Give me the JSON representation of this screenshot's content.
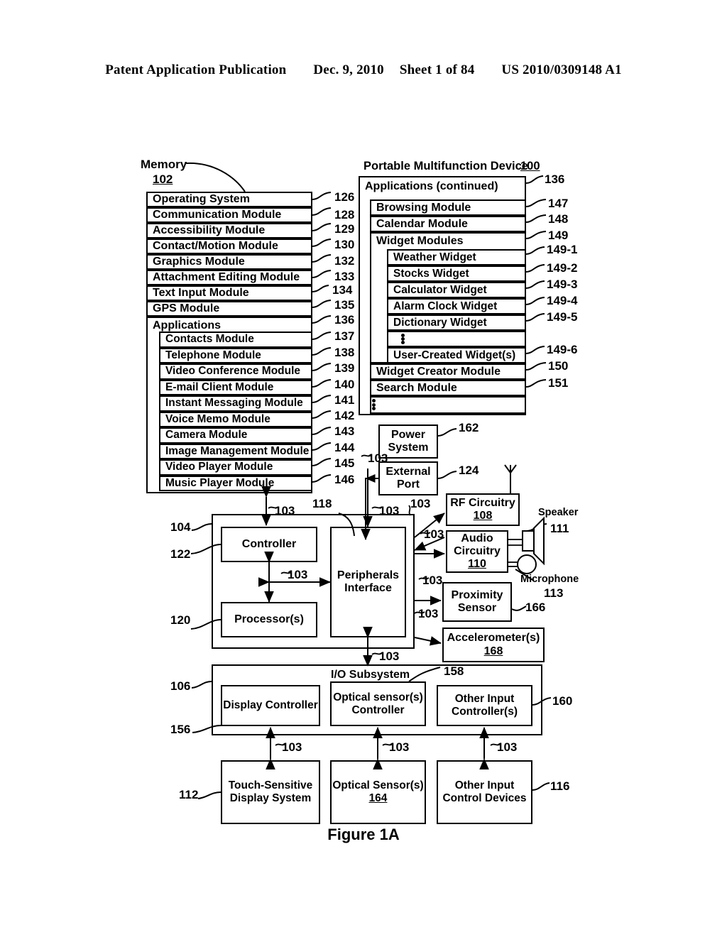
{
  "header": {
    "publication": "Patent Application Publication",
    "date": "Dec. 9, 2010",
    "sheet": "Sheet 1 of 84",
    "number": "US 2010/0309148 A1"
  },
  "figure": {
    "caption": "Figure 1A"
  },
  "memory": {
    "label": "Memory",
    "ref": "102",
    "rows": [
      {
        "label": "Operating System",
        "ref": "126"
      },
      {
        "label": "Communication Module",
        "ref": "128"
      },
      {
        "label": "Accessibility Module",
        "ref": "129"
      },
      {
        "label": "Contact/Motion Module",
        "ref": "130"
      },
      {
        "label": "Graphics Module",
        "ref": "132"
      },
      {
        "label": "Attachment Editing Module",
        "ref": "133"
      },
      {
        "label": "Text Input Module",
        "ref": "134"
      },
      {
        "label": "GPS Module",
        "ref": "135"
      },
      {
        "label": "Applications",
        "ref": "136"
      }
    ],
    "application_rows": [
      {
        "label": "Contacts Module",
        "ref": "137"
      },
      {
        "label": "Telephone Module",
        "ref": "138"
      },
      {
        "label": "Video Conference Module",
        "ref": "139"
      },
      {
        "label": "E-mail Client Module",
        "ref": "140"
      },
      {
        "label": "Instant Messaging Module",
        "ref": "141"
      },
      {
        "label": "Voice Memo Module",
        "ref": "142"
      },
      {
        "label": "Camera Module",
        "ref": "143"
      },
      {
        "label": "Image Management Module",
        "ref": "144"
      },
      {
        "label": "Video Player Module",
        "ref": "145"
      },
      {
        "label": "Music Player Module",
        "ref": "146"
      }
    ]
  },
  "device": {
    "title": "Portable Multifunction Device",
    "ref": "100"
  },
  "applications_continued": {
    "label": "Applications (continued)",
    "ref": "136",
    "rows": [
      {
        "label": "Browsing Module",
        "ref": "147"
      },
      {
        "label": "Calendar Module",
        "ref": "148"
      },
      {
        "label": "Widget Modules",
        "ref": "149"
      }
    ],
    "widgets": [
      {
        "label": "Weather Widget",
        "ref": "149-1"
      },
      {
        "label": "Stocks Widget",
        "ref": "149-2"
      },
      {
        "label": "Calculator Widget",
        "ref": "149-3"
      },
      {
        "label": "Alarm Clock Widget",
        "ref": "149-4"
      },
      {
        "label": "Dictionary Widget",
        "ref": "149-5"
      },
      {
        "label": "User-Created Widget(s)",
        "ref": "149-6"
      }
    ],
    "trailing_rows": [
      {
        "label": "Widget Creator Module",
        "ref": "150"
      },
      {
        "label": "Search Module",
        "ref": "151"
      }
    ]
  },
  "blocks": {
    "power_system": {
      "label": "Power System",
      "ref": "162"
    },
    "external_port": {
      "label": "External Port",
      "ref": "124"
    },
    "rf_circuitry": {
      "label": "RF Circuitry",
      "ref": "108"
    },
    "audio_circuitry": {
      "label": "Audio Circuitry",
      "ref": "110"
    },
    "proximity_sensor": {
      "label": "Proximity Sensor",
      "ref": "166"
    },
    "accelerometers": {
      "label": "Accelerometer(s)",
      "ref": "168"
    },
    "speaker": {
      "label": "Speaker",
      "ref": "111"
    },
    "microphone": {
      "label": "Microphone",
      "ref": "113"
    },
    "controller": {
      "label": "Controller",
      "ref": "122"
    },
    "processors": {
      "label": "Processor(s)",
      "ref": "120"
    },
    "peripherals_interface": {
      "label": "Peripherals Interface",
      "ref": "118"
    },
    "cpu_enclosure_ref": "104",
    "io_subsystem": {
      "label": "I/O Subsystem",
      "ref": "106"
    },
    "display_controller": {
      "label": "Display Controller",
      "ref": "156"
    },
    "optical_sensor_controller": {
      "label": "Optical sensor(s) Controller",
      "ref": "158"
    },
    "other_input_controller": {
      "label": "Other Input Controller(s)",
      "ref": "160"
    },
    "touch_display": {
      "label": "Touch-Sensitive Display System",
      "ref": "112"
    },
    "optical_sensor": {
      "label": "Optical Sensor(s)",
      "ref": "164"
    },
    "other_input_devices": {
      "label": "Other Input Control Devices",
      "ref": "116"
    }
  },
  "bus_label": "103"
}
